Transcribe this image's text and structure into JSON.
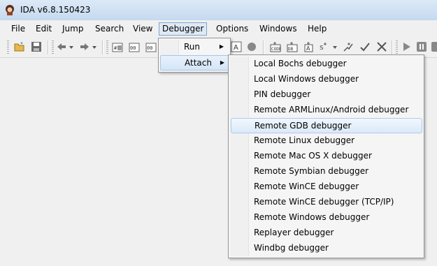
{
  "window": {
    "title": "IDA v6.8.150423"
  },
  "menubar": {
    "items": [
      {
        "label": "File"
      },
      {
        "label": "Edit"
      },
      {
        "label": "Jump"
      },
      {
        "label": "Search"
      },
      {
        "label": "View"
      },
      {
        "label": "Debugger"
      },
      {
        "label": "Options"
      },
      {
        "label": "Windows"
      },
      {
        "label": "Help"
      }
    ]
  },
  "debugger_menu": {
    "items": [
      {
        "label": "Run"
      },
      {
        "label": "Attach"
      }
    ]
  },
  "attach_menu": {
    "items": [
      {
        "label": "Local Bochs debugger"
      },
      {
        "label": "Local Windows debugger"
      },
      {
        "label": "PIN debugger"
      },
      {
        "label": "Remote ARMLinux/Android debugger"
      },
      {
        "label": "Remote GDB debugger",
        "highlighted": true
      },
      {
        "label": "Remote Linux debugger"
      },
      {
        "label": "Remote Mac OS X debugger"
      },
      {
        "label": "Remote Symbian debugger"
      },
      {
        "label": "Remote WinCE debugger"
      },
      {
        "label": "Remote WinCE debugger (TCP/IP)"
      },
      {
        "label": "Remote Windows debugger"
      },
      {
        "label": "Replayer debugger"
      },
      {
        "label": "Windbg debugger"
      }
    ]
  },
  "toolbar": {
    "icons": [
      "open-icon",
      "save-icon",
      "back-icon",
      "forward-icon",
      "hex-view-icon",
      "hex-view-2-icon",
      "hex-view-3-icon",
      "text-icon",
      "record-icon",
      "code-icon",
      "data-icon",
      "string-icon",
      "struct-icon",
      "ok-icon",
      "cross-icon",
      "play-icon",
      "pause-icon",
      "stop-icon"
    ]
  }
}
